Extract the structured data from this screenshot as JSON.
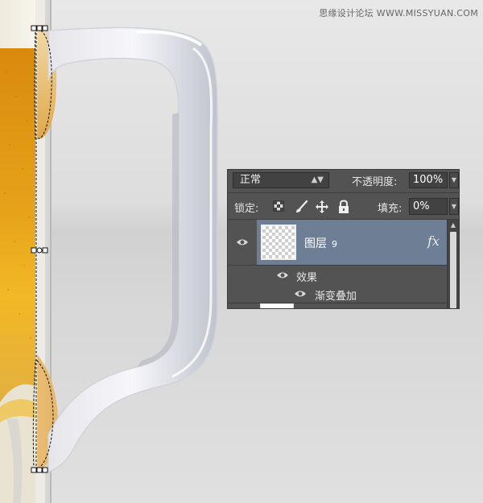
{
  "watermark": "思缘设计论坛 WWW.MISSYUAN.COM",
  "panel": {
    "blend_mode": "正常",
    "opacity_label": "不透明度:",
    "opacity_value": "100%",
    "lock_label": "锁定:",
    "fill_label": "填充:",
    "fill_value": "0%",
    "layer": {
      "name": "图层",
      "number": "9",
      "fx": "fx",
      "thumbnail": "transparent-checkerboard"
    },
    "effects_label": "效果",
    "effect_item": "渐变叠加"
  },
  "icons": {
    "lock_transparent": "checkerboard-lock-icon",
    "lock_paint": "brush-icon",
    "lock_move": "move-icon",
    "lock_all": "padlock-icon",
    "visibility": "eye-icon"
  },
  "colors": {
    "panel_bg": "#535353",
    "selected_layer": "#6e7f95",
    "beer": "#e8a317",
    "foam": "#f2efe0"
  }
}
